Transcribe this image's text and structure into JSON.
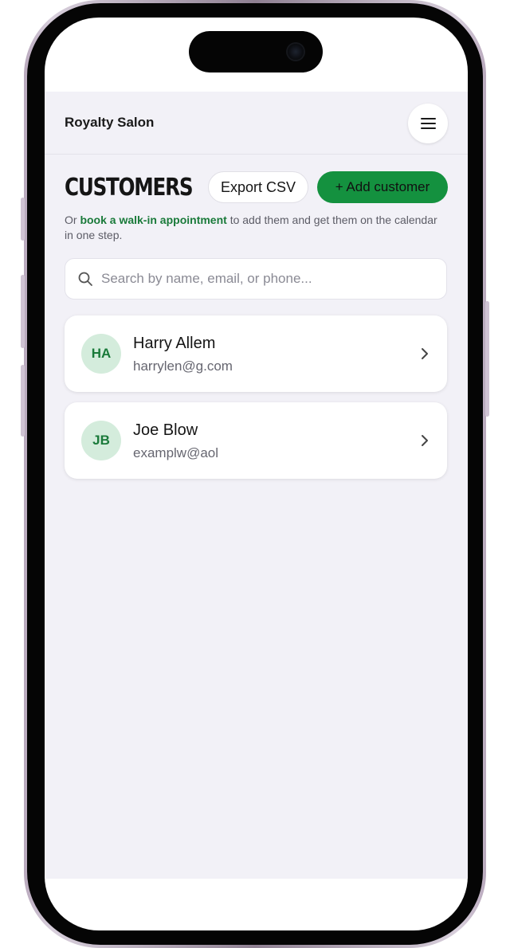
{
  "app": {
    "brand": "Royalty Salon"
  },
  "page": {
    "title": "CUSTOMERS",
    "export_label": "Export CSV",
    "add_label": "+ Add customer",
    "hint": {
      "prefix": "Or ",
      "link": "book a walk-in appointment",
      "suffix": " to add them and get them on the calendar in one step."
    },
    "search_placeholder": "Search by name, email, or phone..."
  },
  "customers": [
    {
      "initials": "HA",
      "name": "Harry Allem",
      "email": "harrylen@g.com"
    },
    {
      "initials": "JB",
      "name": "Joe Blow",
      "email": "examplw@aol"
    }
  ],
  "colors": {
    "accent": "#14913f",
    "avatar_bg": "#d4ecdc",
    "app_bg": "#f2f1f7"
  },
  "icons": [
    "menu-icon",
    "search-icon",
    "chevron-right-icon"
  ]
}
